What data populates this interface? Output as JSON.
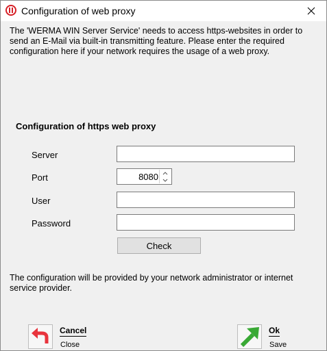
{
  "window": {
    "title": "Configuration of web proxy",
    "close_label": "×"
  },
  "intro": {
    "text": "The 'WERMA WIN Server Service' needs to access https-websites in order to send an E-Mail via built-in transmitting feature. Please enter the required configuration here if your network requires the usage of a web proxy."
  },
  "proxy": {
    "heading": "Configuration of https web proxy",
    "server_label": "Server",
    "server_value": "",
    "port_label": "Port",
    "port_value": "8080",
    "user_label": "User",
    "user_value": "",
    "password_label": "Password",
    "password_value": "",
    "check_label": "Check"
  },
  "note": {
    "text": "The configuration will be provided by your network administrator or internet service provider."
  },
  "actions": {
    "cancel_title": "Cancel",
    "cancel_sub": "Close",
    "ok_title": "Ok",
    "ok_sub": "Save"
  },
  "colors": {
    "brand_red": "#d61f26",
    "ok_green": "#39a935",
    "cancel_red": "#e8343d"
  }
}
